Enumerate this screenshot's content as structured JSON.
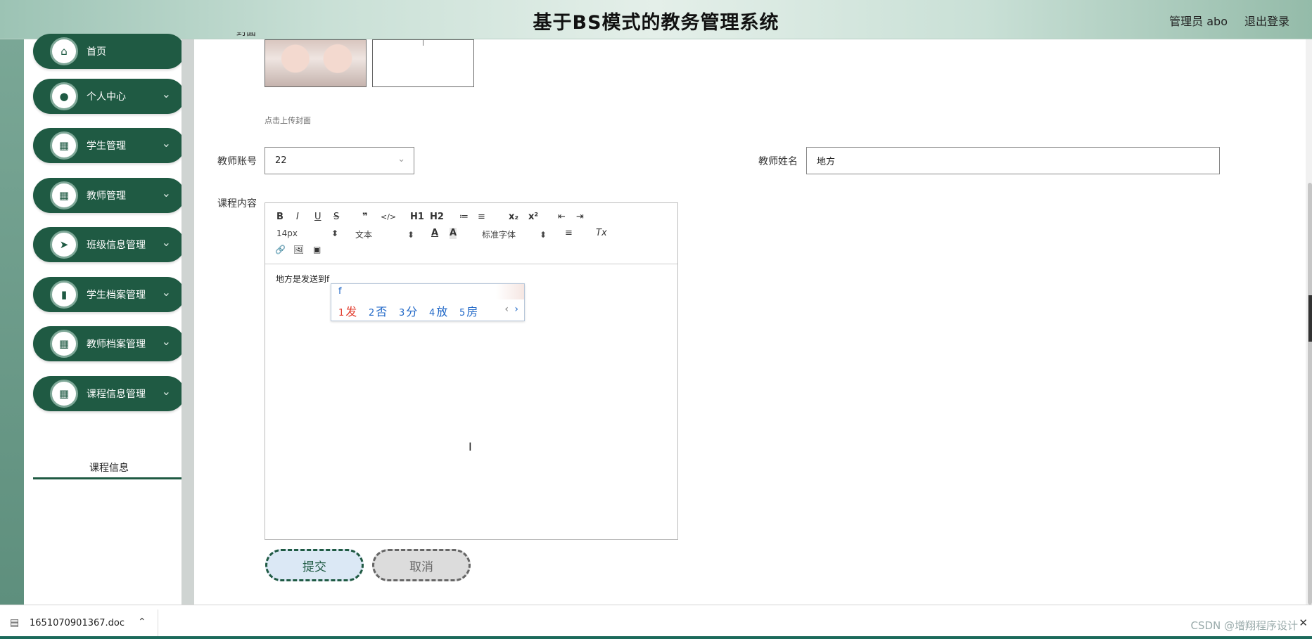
{
  "header": {
    "title": "基于BS模式的教务管理系统",
    "user": "管理员 abo",
    "logout": "退出登录"
  },
  "sidebar": {
    "items": [
      {
        "label": "首页",
        "icon": "home-icon",
        "glyph": "⌂"
      },
      {
        "label": "个人中心",
        "icon": "user-icon",
        "glyph": "●"
      },
      {
        "label": "学生管理",
        "icon": "grid-icon",
        "glyph": "▦"
      },
      {
        "label": "教师管理",
        "icon": "grid-icon",
        "glyph": "▦"
      },
      {
        "label": "班级信息管理",
        "icon": "send-icon",
        "glyph": "➤"
      },
      {
        "label": "学生档案管理",
        "icon": "book-icon",
        "glyph": "▮"
      },
      {
        "label": "教师档案管理",
        "icon": "grid-icon",
        "glyph": "▦"
      },
      {
        "label": "课程信息管理",
        "icon": "grid-icon",
        "glyph": "▦"
      }
    ],
    "submenu": "课程信息",
    "chevron": "⌄"
  },
  "form": {
    "cover_label": "封面",
    "upload_hint": "点击上传封面",
    "teacher_account_label": "教师账号",
    "teacher_account_value": "22",
    "teacher_name_label": "教师姓名",
    "teacher_name_value": "地方",
    "content_label": "课程内容",
    "content_text": "地方是发送到f",
    "submit": "提交",
    "cancel": "取消"
  },
  "editor": {
    "toolbar_row1": [
      "B",
      "I",
      "U",
      "S",
      "❞",
      "</>",
      "H1",
      "H2",
      "≔",
      "≡",
      "x₂",
      "x²",
      "⇤",
      "⇥"
    ],
    "font_size": "14px",
    "block_type": "文本",
    "font_family": "标准字体",
    "color_a": "A",
    "bg_a": "A",
    "align": "≡",
    "clear": "Tx",
    "row3": [
      "🔗",
      "🖼",
      "▣"
    ],
    "select_arrow": "⬍"
  },
  "ime": {
    "pinyin": "f",
    "candidates": [
      {
        "num": "1",
        "char": "发"
      },
      {
        "num": "2",
        "char": "否"
      },
      {
        "num": "3",
        "char": "分"
      },
      {
        "num": "4",
        "char": "放"
      },
      {
        "num": "5",
        "char": "房"
      }
    ],
    "prev": "‹",
    "next": "›"
  },
  "download": {
    "filename": "1651070901367.doc",
    "chevron": "⌃",
    "watermark": "CSDN @增翔程序设计",
    "close": "✕"
  },
  "colors": {
    "accent": "#1f5a43",
    "header_bg": "#c9e0d6",
    "submit_bg": "#dbe8f5",
    "ime_first": "#e23d2e"
  }
}
